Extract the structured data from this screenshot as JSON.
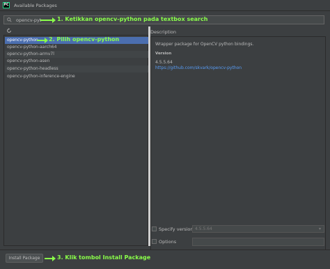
{
  "window": {
    "title": "Available Packages",
    "app_icon": "PC"
  },
  "search": {
    "value": "opencv-pyt"
  },
  "packages": [
    "opencv-python",
    "opencv-python-aarch64",
    "opencv-python-armv7l",
    "opencv-python-asen",
    "opencv-python-headless",
    "opencv-python-inference-engine"
  ],
  "selected_index": 0,
  "description": {
    "label": "Description",
    "text": "Wrapper package for OpenCV python bindings.",
    "version_label": "Version",
    "version": "4.5.5.64",
    "link": "https://github.com/skvark/opencv-python"
  },
  "options": {
    "specify_version_label": "Specify version",
    "specify_version_value": "4.5.5.64",
    "options_label": "Options"
  },
  "install_button": "Install Package",
  "annotations": {
    "step1": "1. Ketikkan opencv-python pada textbox search",
    "step2": "2. Pilih opencv-python",
    "step3": "3. Klik tombol Install Package",
    "color": "#8aff4a"
  },
  "colors": {
    "selection": "#4b6eaf",
    "link": "#589df6",
    "background": "#3c3f41"
  }
}
